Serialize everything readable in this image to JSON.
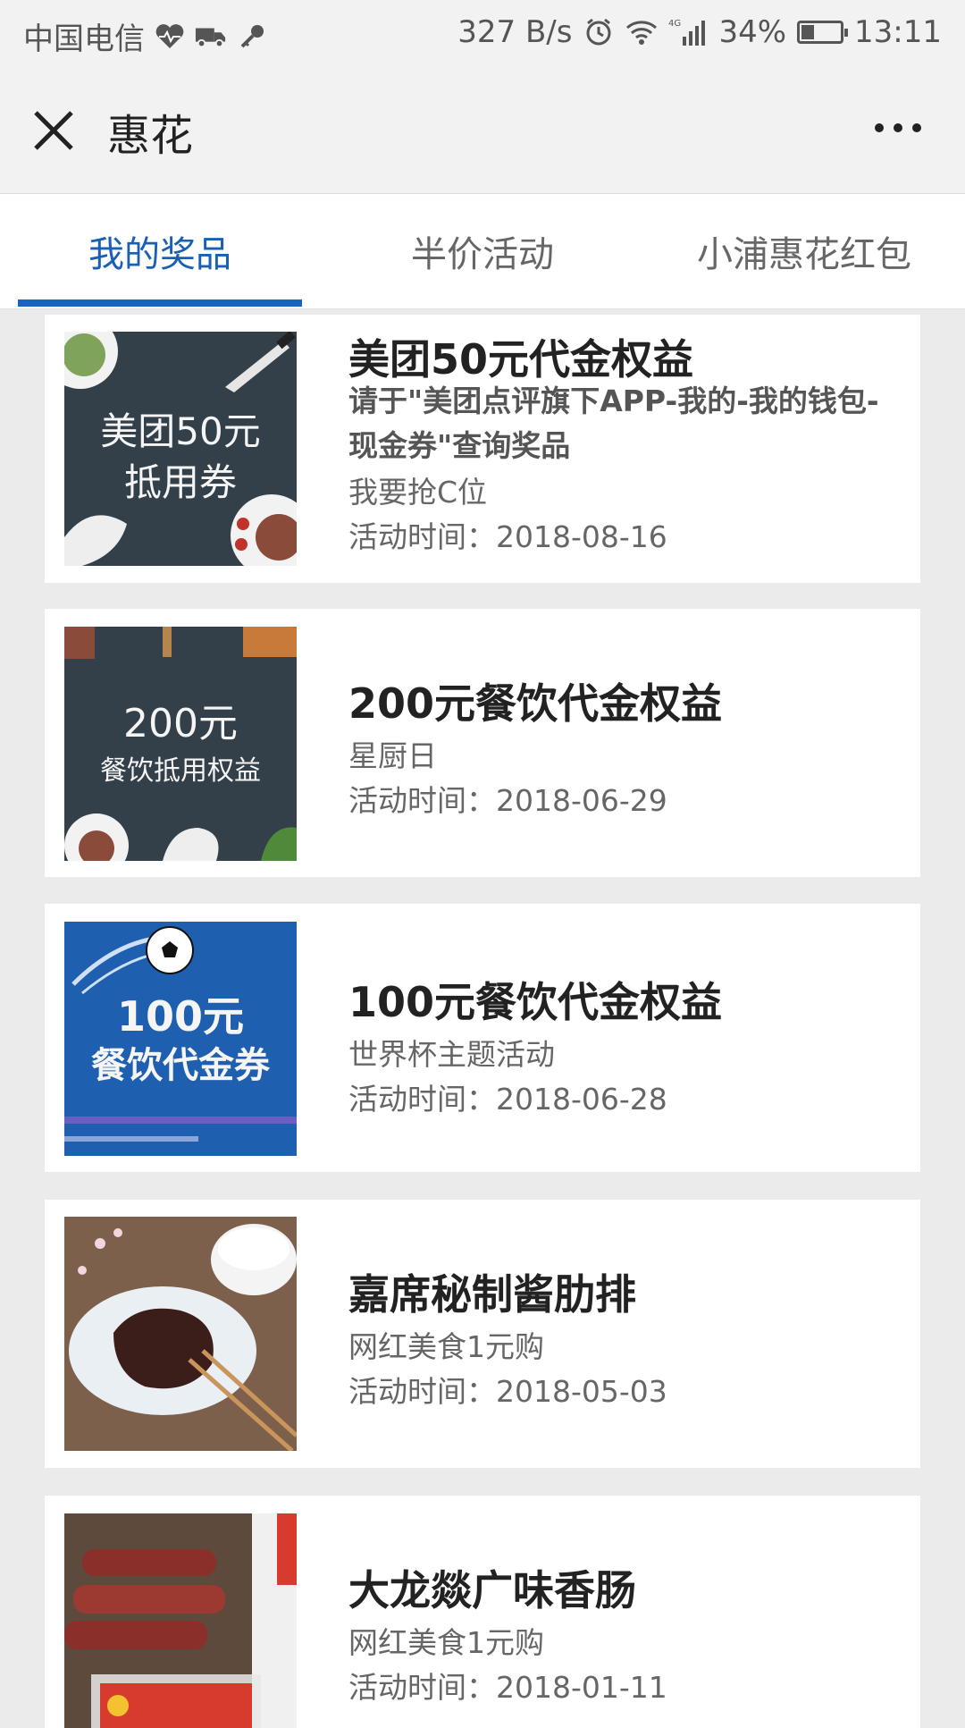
{
  "status_bar": {
    "carrier": "中国电信",
    "speed": "327 B/s",
    "network": "4G",
    "battery": "34%",
    "battery_level": 0.34,
    "time": "13:11"
  },
  "title_bar": {
    "title": "惠花"
  },
  "tabs": [
    {
      "label": "我的奖品",
      "active": true
    },
    {
      "label": "半价活动",
      "active": false
    },
    {
      "label": "小浦惠花红包",
      "active": false
    }
  ],
  "prizes": [
    {
      "title": "美团50元代金权益",
      "note": "请于\"美团点评旗下APP-我的-我的钱包-现金券\"查询奖品",
      "subtitle": "我要抢C位",
      "time": "活动时间：2018-08-16",
      "thumb_line1": "美团50元",
      "thumb_line2": "抵用券",
      "thumb_color": "#2f3a42"
    },
    {
      "title": "200元餐饮代金权益",
      "subtitle": "星厨日",
      "time": "活动时间：2018-06-29",
      "thumb_line1": "200元",
      "thumb_line2": "餐饮抵用权益",
      "thumb_color": "#2f3a42"
    },
    {
      "title": "100元餐饮代金权益",
      "subtitle": "世界杯主题活动",
      "time": "活动时间：2018-06-28",
      "thumb_line1": "100元",
      "thumb_line2": "餐饮代金券",
      "thumb_color": "#1f5fb0"
    },
    {
      "title": "嘉席秘制酱肋排",
      "subtitle": "网红美食1元购",
      "time": "活动时间：2018-05-03",
      "thumb_color": "#8a6a52"
    },
    {
      "title": "大龙燚广味香肠",
      "subtitle": "网红美食1元购",
      "time": "活动时间：2018-01-11",
      "thumb_color": "#6b5443"
    }
  ]
}
